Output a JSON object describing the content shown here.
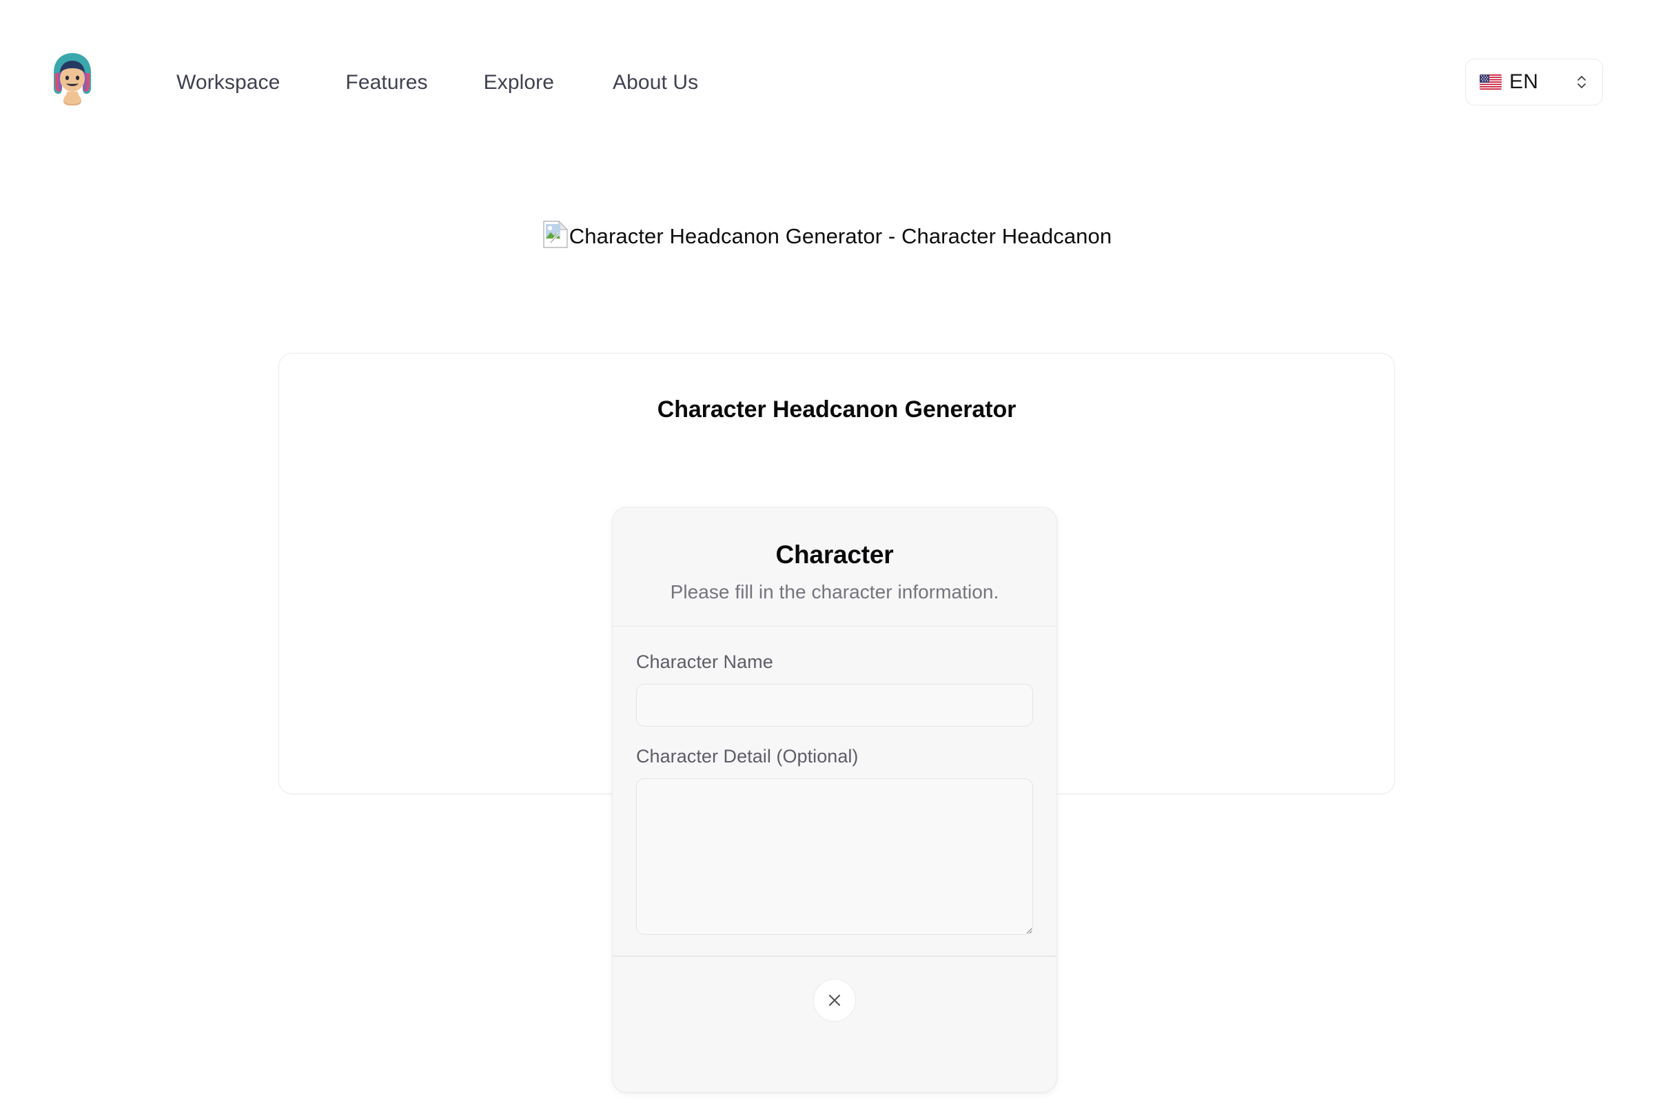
{
  "header": {
    "logo_icon": "character-avatar-logo",
    "nav": [
      {
        "label": "Workspace"
      },
      {
        "label": "Features"
      },
      {
        "label": "Explore"
      },
      {
        "label": "About Us"
      }
    ],
    "language_selector": {
      "flag_icon": "us-flag-icon",
      "code": "EN",
      "chevron_icon": "chevron-up-down-icon"
    }
  },
  "hero": {
    "broken_image_icon": "broken-image-icon",
    "alt_text": "Character Headcanon Generator - Character Headcanon"
  },
  "outer_card": {
    "title": "Character Headcanon Generator"
  },
  "character_card": {
    "title": "Character",
    "subtitle": "Please fill in the character information.",
    "fields": [
      {
        "label": "Character Name",
        "value": "",
        "placeholder": ""
      },
      {
        "label": "Character Detail (Optional)",
        "value": "",
        "placeholder": ""
      }
    ],
    "footer": {
      "close_icon": "close-x-icon"
    }
  },
  "colors": {
    "page_background": "#ffffff",
    "nav_text": "#3f4050",
    "card_background": "#f7f7f8",
    "card_border": "#ececed",
    "input_border": "#e4e4e7",
    "label_text": "#5d5d66",
    "subtitle_text": "#74747c",
    "heading_text": "#09090b"
  }
}
